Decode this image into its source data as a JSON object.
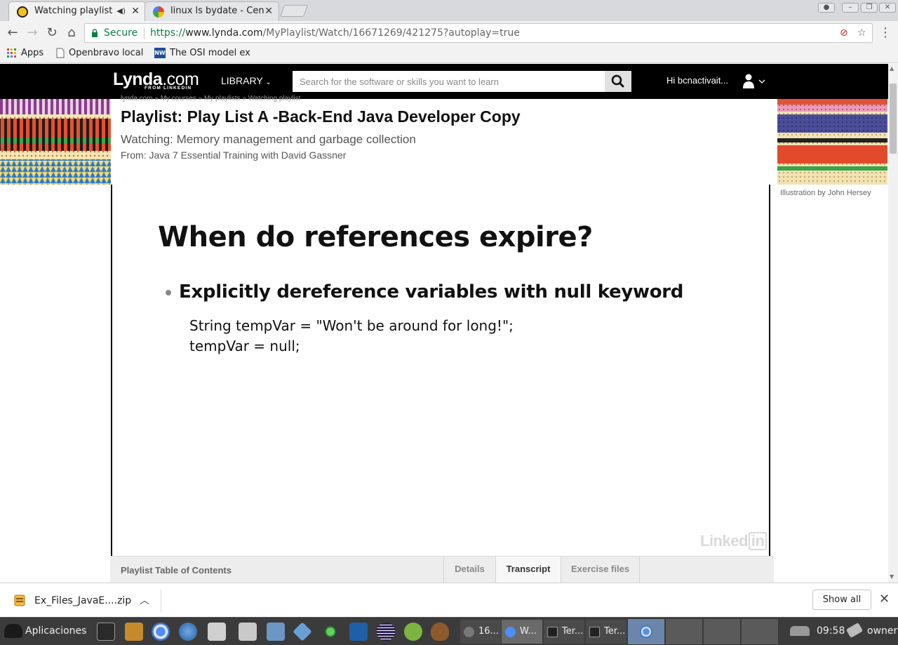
{
  "browser": {
    "tabs": [
      {
        "title": "Watching playlist",
        "active": true
      },
      {
        "title": "linux ls bydate - Cen",
        "active": false
      }
    ],
    "window_controls": [
      "minimize",
      "maximize",
      "close"
    ],
    "omnibox": {
      "secure_label": "Secure",
      "url_scheme": "https://",
      "url_host": "www.lynda.com",
      "url_path": "/MyPlaylist/Watch/16671269/421275?autoplay=true"
    },
    "bookmarks": [
      {
        "label": "Apps",
        "icon": "apps-grid-icon"
      },
      {
        "label": "Openbravo local",
        "icon": "page-icon"
      },
      {
        "label": "The OSI model ex",
        "icon": "nw-icon"
      }
    ]
  },
  "site": {
    "logo": "Lynda",
    "logo_suffix": ".com",
    "logo_tagline": "FROM LINKEDIN",
    "library_label": "LIBRARY",
    "search_placeholder": "Search for the software or skills you want to learn",
    "greeting": "Hi bcnactivait...",
    "breadcrumb": "lynda.com  »  My courses  »  My playlists  »  Watching playlist",
    "playlist_title": "Playlist: Play List A -Back-End Java Developer Copy",
    "watching": "Watching: Memory management and garbage collection",
    "from": "From: Java 7 Essential Training with David Gassner",
    "illustration_credit": "Illustration by John Hersey"
  },
  "video": {
    "slide_title": "When do references expire?",
    "bullet": "Explicitly dereference variables with null keyword",
    "code": [
      "String tempVar = \"Won't be around for long!\";",
      "tempVar = null;"
    ],
    "watermark_text": "Linked",
    "watermark_box": "in"
  },
  "player_tabs": {
    "toc_label": "Playlist Table of Contents",
    "tabs": [
      {
        "label": "Details",
        "active": false
      },
      {
        "label": "Transcript",
        "active": true
      },
      {
        "label": "Exercise files",
        "active": false
      }
    ]
  },
  "download_bar": {
    "filename": "Ex_Files_JavaE....zip",
    "show_all_label": "Show all"
  },
  "taskbar": {
    "apps_label": "Aplicaciones",
    "windows": [
      {
        "label": "16..."
      },
      {
        "label": "W..."
      },
      {
        "label": "Ter..."
      },
      {
        "label": "Ter..."
      }
    ],
    "clock": "09:58",
    "user": "owner"
  },
  "colors": {
    "lynda_header": "#000000",
    "secure_green": "#0b8043",
    "taskbar": "#3b3b3b"
  }
}
